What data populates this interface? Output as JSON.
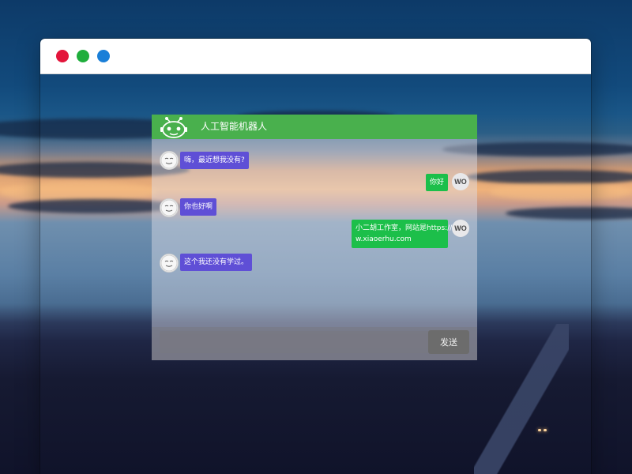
{
  "window": {
    "controls": [
      {
        "name": "close",
        "color": "#e3153b"
      },
      {
        "name": "minimize",
        "color": "#1fae3c"
      },
      {
        "name": "maximize",
        "color": "#1a7fd8"
      }
    ]
  },
  "chat": {
    "title": "人工智能机器人",
    "header_color": "#49b04d",
    "bot_avatar_icon": "smiley-face-icon",
    "header_logo_icon": "robot-icon",
    "messages": [
      {
        "sender": "bot",
        "text": "嗨，最近想我没有?"
      },
      {
        "sender": "user",
        "avatar": "WO",
        "text": "你好"
      },
      {
        "sender": "bot",
        "text": "你也好啊"
      },
      {
        "sender": "user",
        "avatar": "WO",
        "text_line1": "小二胡工作室，网站是https://ww",
        "text_line2": "w.xiaoerhu.com"
      },
      {
        "sender": "bot",
        "text": "这个我还没有学过。"
      }
    ],
    "input": {
      "value": "",
      "placeholder": ""
    },
    "send_label": "发送",
    "colors": {
      "bot_bubble": "#5f4fd6",
      "user_bubble": "#1cbf4a"
    }
  }
}
